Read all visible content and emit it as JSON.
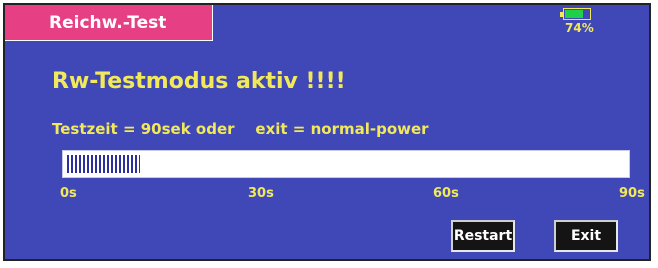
{
  "header": {
    "title": "Reichw.-Test"
  },
  "battery": {
    "percent_label": "74%",
    "level": 0.74,
    "fill_color": "#20d04a",
    "outline_color": "#f2e95a"
  },
  "main": {
    "headline": "Rw-Testmodus aktiv !!!!",
    "info_test_time": "Testzeit = 90sek oder",
    "info_exit": "exit = normal-power"
  },
  "progress": {
    "fraction": 0.13,
    "labels": [
      "0s",
      "30s",
      "60s",
      "90s"
    ]
  },
  "buttons": {
    "restart_label": "Restart",
    "exit_label": "Exit"
  },
  "colors": {
    "background": "#4048b8",
    "title_tab": "#e73f84",
    "text_accent": "#f2e95a"
  }
}
